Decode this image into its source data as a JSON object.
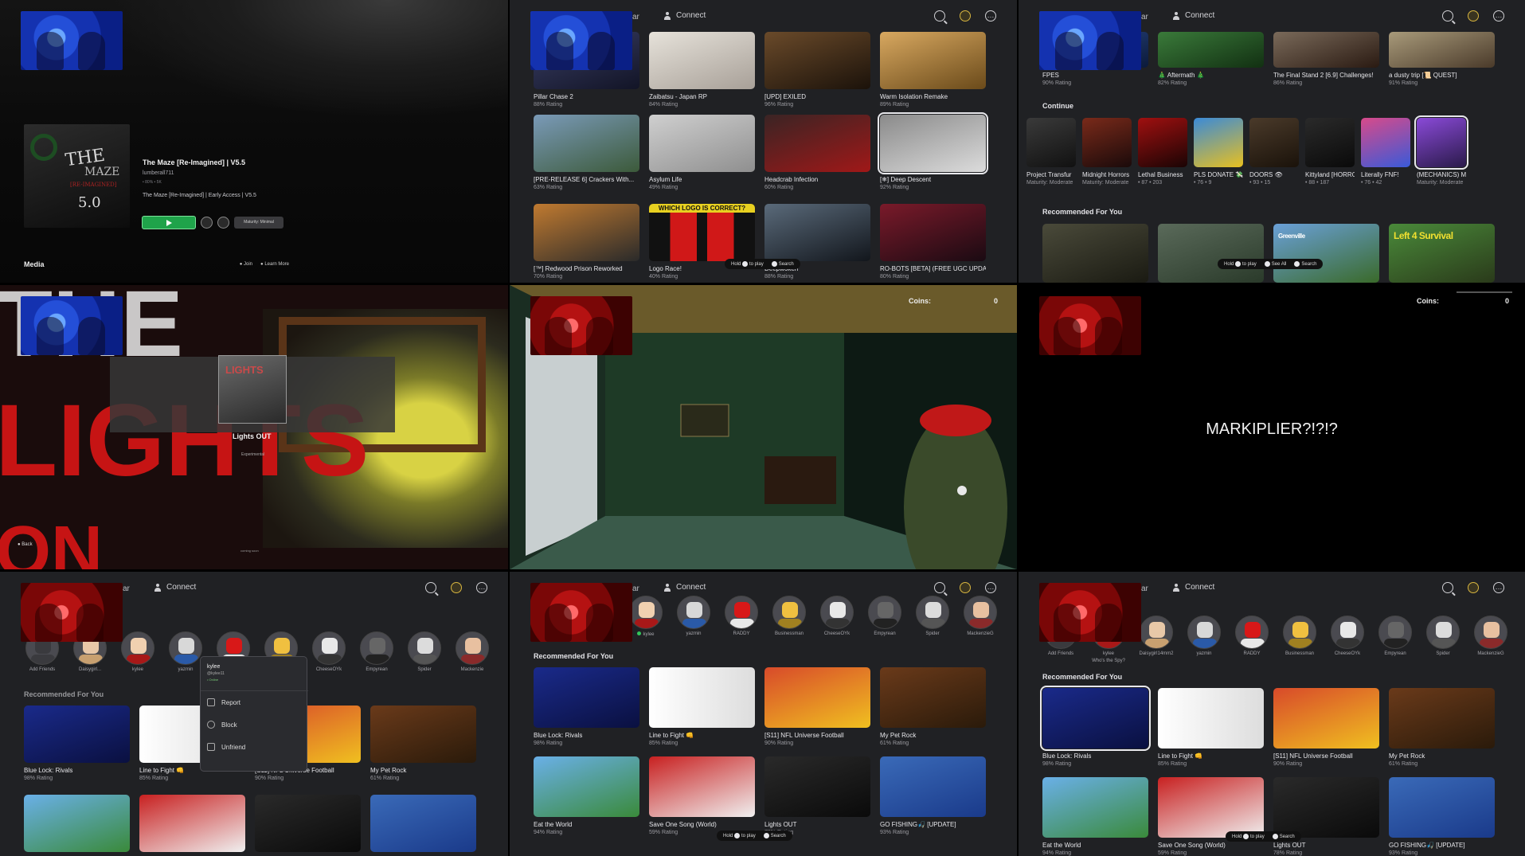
{
  "panel1": {
    "game_title": "The Maze [Re-Imagined] | V5.5",
    "developer": "lumberall711",
    "meta": "• 80%  • 5K",
    "description": "The Maze [Re-Imagined] | Early Access | V5.5",
    "thumb_logo": "THE",
    "thumb_logo2": "MAZE",
    "thumb_logo3": "[RE-IMAGINED]",
    "thumb_logo4": "5.0",
    "maturity": "Maturity: Minimal",
    "media_heading": "Media",
    "join_label": "Join",
    "learn_label": "Learn More"
  },
  "topbar": {
    "ar": "ar",
    "connect": "Connect"
  },
  "panel2": {
    "tiles": [
      {
        "title": "Pillar Chase 2",
        "rating": "88% Rating",
        "bg": "linear-gradient(160deg,#3a3f66,#121426)"
      },
      {
        "title": "Zaibatsu - Japan RP",
        "rating": "84% Rating",
        "bg": "linear-gradient(160deg,#e6e2da,#a8a098)"
      },
      {
        "title": "[UPD] EXILED",
        "rating": "96% Rating",
        "bg": "linear-gradient(160deg,#6a4a2a,#1b120a)"
      },
      {
        "title": "Warm Isolation Remake",
        "rating": "89% Rating",
        "bg": "linear-gradient(160deg,#d8a860,#6a4a1a)"
      },
      {
        "title": "[PRE-RELEASE 6] Crackers With...",
        "rating": "63% Rating",
        "bg": "linear-gradient(160deg,#7a9ab8,#3c5a3a)"
      },
      {
        "title": "Asylum Life",
        "rating": "49% Rating",
        "bg": "linear-gradient(160deg,#cfcfcf,#8f8f8f)"
      },
      {
        "title": "Headcrab Infection",
        "rating": "60% Rating",
        "bg": "linear-gradient(160deg,#3a2424,#a01818)"
      },
      {
        "title": "[❄] Deep Descent",
        "rating": "92% Rating",
        "bg": "linear-gradient(160deg,#8a8a8a,#dcdcdc)"
      },
      {
        "title": "[™] Redwood Prison Reworked",
        "rating": "70% Rating",
        "bg": "linear-gradient(160deg,#c07a30,#2a2a2a)"
      },
      {
        "title": "Logo Race!",
        "rating": "40% Rating",
        "bg": "linear-gradient(90deg,#111 0 20%,#d01818 20% 45%,#111 45% 55%,#d01818 55% 80%,#111 80%)"
      },
      {
        "title": "Deepwoken",
        "rating": "88% Rating",
        "bg": "linear-gradient(160deg,#5a6a7a,#12161c)"
      },
      {
        "title": "RO-BOTS [BETA] (FREE UGC UPDA...",
        "rating": "80% Rating",
        "bg": "linear-gradient(160deg,#7a1a2a,#1a0a12)"
      }
    ],
    "logo_race_text": "WHICH LOGO IS CORRECT?",
    "hint": {
      "hold": "Hold",
      "play": "to play",
      "search": "Search"
    }
  },
  "panel3": {
    "top_tiles": [
      {
        "title": "FPES",
        "rating": "90% Rating",
        "bg": "linear-gradient(160deg,#2a4a8a,#0c1a3a)"
      },
      {
        "title": "🎄 Aftermath 🎄",
        "rating": "82% Rating",
        "bg": "linear-gradient(160deg,#3a7a3a,#123012)"
      },
      {
        "title": "The Final Stand 2 [6.9] Challenges!",
        "rating": "86% Rating",
        "bg": "linear-gradient(160deg,#7a6a5a,#2a1a12)"
      },
      {
        "title": "a dusty trip [📜 QUEST]",
        "rating": "91% Rating",
        "bg": "linear-gradient(160deg,#a89a7a,#4a3a2a)"
      }
    ],
    "continue_heading": "Continue",
    "continue_items": [
      {
        "title": "Project Transfur",
        "sub": "Maturity: Moderate",
        "bg": "linear-gradient(160deg,#3a3a3a,#111)"
      },
      {
        "title": "Midnight Horrors",
        "sub": "Maturity: Moderate",
        "bg": "linear-gradient(160deg,#7a2a1a,#1a0a0a)"
      },
      {
        "title": "Lethal Business",
        "sub": "• 87  • 203",
        "bg": "linear-gradient(160deg,#a01010,#1a0404)"
      },
      {
        "title": "PLS DONATE 💸",
        "sub": "• 76  • 9",
        "bg": "linear-gradient(160deg,#3a8ad8,#e8c020)"
      },
      {
        "title": "DOORS 👁",
        "sub": "• 93  • 15",
        "bg": "linear-gradient(160deg,#4a3a2a,#1a120a)"
      },
      {
        "title": "Kittyland [HORROR][Beta]",
        "sub": "• 88  • 187",
        "bg": "linear-gradient(160deg,#2a2a2a,#0a0a0a)"
      },
      {
        "title": "Literally FNF!",
        "sub": "• 76  • 42",
        "bg": "linear-gradient(160deg,#d84a8a,#3a5ad8)"
      },
      {
        "title": "(MECHANICS) Monday Morning...",
        "sub": "Maturity: Moderate",
        "bg": "linear-gradient(160deg,#8a4ad8,#2a1a4a)"
      }
    ],
    "rec_heading": "Recommended For You",
    "rec_tiles": [
      {
        "title": "",
        "bg": "linear-gradient(160deg,#4a4a3a,#1a1a12)"
      },
      {
        "title": "",
        "bg": "linear-gradient(160deg,#5a6a5a,#2a3a2a)"
      },
      {
        "title": "Greenville",
        "bg": "linear-gradient(160deg,#6aa0d8,#3a6a2a)"
      },
      {
        "title": "Left 4 Survival",
        "bg": "linear-gradient(160deg,#4a8a3a,#2a3a1a)"
      }
    ],
    "hint": {
      "hold": "Hold",
      "play": "to play",
      "seeall": "See All",
      "search": "Search"
    }
  },
  "panel4": {
    "big_lines": [
      "THE",
      "LIGHTS",
      "ON"
    ],
    "thumb_text": "LIGHTS",
    "title": "Lights OUT",
    "subtitle": "Experimental",
    "back": "Back",
    "coming": "coming soon"
  },
  "panel5": {
    "coins_label": "Coins:",
    "coins_value": "0"
  },
  "panel6": {
    "coins_label": "Coins:",
    "coins_value": "0",
    "message": "MARKIPLIER?!?!?"
  },
  "panel7": {
    "friends": [
      {
        "name": "Add Friends",
        "head": "#3a3a3e",
        "body": "#3a3a3e"
      },
      {
        "name": "Daisygirl...",
        "head": "#e8c8a8",
        "body": "#c8a070"
      },
      {
        "name": "kylee",
        "head": "#f0d0b0",
        "body": "#a81818"
      },
      {
        "name": "yazmin",
        "head": "#d8d8d8",
        "body": "#2a5aa8"
      },
      {
        "name": "RADDY",
        "head": "#d81818",
        "body": "#e8e8e8"
      },
      {
        "name": "",
        "head": "#f0c040",
        "body": "#a08020"
      },
      {
        "name": "CheeseOYk",
        "head": "#e8e8e8",
        "body": "#333"
      },
      {
        "name": "Empyrean",
        "head": "#666",
        "body": "#222"
      },
      {
        "name": "Spider",
        "head": "#dcdcdc",
        "body": "#555"
      },
      {
        "name": "Mackenzie",
        "head": "#e8c0a0",
        "body": "#8a2a2a"
      }
    ],
    "rec_heading": "Recommended For You",
    "tiles": [
      {
        "title": "Blue Lock: Rivals",
        "rating": "98% Rating",
        "bg": "linear-gradient(160deg,#1a2a8a,#0a1040)"
      },
      {
        "title": "Line to Fight 👊",
        "rating": "85% Rating",
        "bg": "linear-gradient(90deg,#fff,#ddd)"
      },
      {
        "title": "[S11] NFL Universe Football",
        "rating": "90% Rating",
        "bg": "linear-gradient(160deg,#d84a2a,#f0c020)"
      },
      {
        "title": "My Pet Rock",
        "rating": "61% Rating",
        "bg": "linear-gradient(160deg,#6a3a1a,#2a1a0a)"
      }
    ],
    "row2": [
      {
        "bg": "linear-gradient(160deg,#6ab0e8,#3a8a3a)"
      },
      {
        "bg": "linear-gradient(160deg,#c82020,#f0f0f0)"
      },
      {
        "bg": "linear-gradient(160deg,#2a2a2a,#0a0a0a)"
      },
      {
        "bg": "linear-gradient(160deg,#3a6ab8,#1a3a8a)"
      }
    ],
    "menu": {
      "name": "kylee",
      "handle": "@kylee11",
      "status": "• Online",
      "report": "Report",
      "block": "Block",
      "unfriend": "Unfriend"
    }
  },
  "panel8": {
    "friends": [
      {
        "name": "kylee",
        "online": true,
        "head": "#f0d0b0",
        "body": "#a81818"
      },
      {
        "name": "yazmin",
        "online": false,
        "head": "#d8d8d8",
        "body": "#2a5aa8"
      },
      {
        "name": "RADDY",
        "online": false,
        "head": "#d81818",
        "body": "#e8e8e8"
      },
      {
        "name": "Businessman",
        "online": false,
        "head": "#f0c040",
        "body": "#a08020"
      },
      {
        "name": "CheeseOYk",
        "online": false,
        "head": "#e8e8e8",
        "body": "#333"
      },
      {
        "name": "Empyrean",
        "online": false,
        "head": "#666",
        "body": "#222"
      },
      {
        "name": "Spider",
        "online": false,
        "head": "#dcdcdc",
        "body": "#555"
      },
      {
        "name": "MackenzieG",
        "online": false,
        "head": "#e8c0a0",
        "body": "#8a2a2a"
      }
    ],
    "rec_heading": "Recommended For You",
    "tiles": [
      {
        "title": "Blue Lock: Rivals",
        "rating": "98% Rating",
        "bg": "linear-gradient(160deg,#1a2a8a,#0a1040)"
      },
      {
        "title": "Line to Fight 👊",
        "rating": "85% Rating",
        "bg": "linear-gradient(90deg,#fff,#ddd)"
      },
      {
        "title": "[S11] NFL Universe Football",
        "rating": "90% Rating",
        "bg": "linear-gradient(160deg,#d84a2a,#f0c020)"
      },
      {
        "title": "My Pet Rock",
        "rating": "61% Rating",
        "bg": "linear-gradient(160deg,#6a3a1a,#2a1a0a)"
      },
      {
        "title": "Eat the World",
        "rating": "94% Rating",
        "bg": "linear-gradient(160deg,#6ab0e8,#3a8a3a)"
      },
      {
        "title": "Save One Song (World)",
        "rating": "59% Rating",
        "bg": "linear-gradient(160deg,#c82020,#f0f0f0)"
      },
      {
        "title": "Lights OUT",
        "rating": "78% Rating",
        "bg": "linear-gradient(160deg,#2a2a2a,#0a0a0a)"
      },
      {
        "title": "GO FISHING🎣 [UPDATE]",
        "rating": "93% Rating",
        "bg": "linear-gradient(160deg,#3a6ab8,#1a3a8a)"
      }
    ],
    "hint": {
      "hold": "Hold",
      "play": "to play",
      "search": "Search"
    }
  },
  "panel9": {
    "friends": [
      {
        "name": "Add Friends",
        "sub": "",
        "head": "#3a3a3e",
        "body": "#3a3a3e"
      },
      {
        "name": "kylee",
        "sub": "Who's the Spy?",
        "head": "#f0d0b0",
        "body": "#a81818"
      },
      {
        "name": "Daisygirl14mm2",
        "sub": "",
        "head": "#e8c8a8",
        "body": "#c8a070"
      },
      {
        "name": "yazmin",
        "sub": "",
        "head": "#d8d8d8",
        "body": "#2a5aa8"
      },
      {
        "name": "RADDY",
        "sub": "",
        "head": "#d81818",
        "body": "#e8e8e8"
      },
      {
        "name": "Businessman",
        "sub": "",
        "head": "#f0c040",
        "body": "#a08020"
      },
      {
        "name": "CheeseOYk",
        "sub": "",
        "head": "#e8e8e8",
        "body": "#333"
      },
      {
        "name": "Empyrean",
        "sub": "",
        "head": "#666",
        "body": "#222"
      },
      {
        "name": "Spider",
        "sub": "",
        "head": "#dcdcdc",
        "body": "#555"
      },
      {
        "name": "MackenzieG",
        "sub": "",
        "head": "#e8c0a0",
        "body": "#8a2a2a"
      }
    ],
    "rec_heading": "Recommended For You",
    "tiles": [
      {
        "title": "Blue Lock: Rivals",
        "rating": "98% Rating",
        "bg": "linear-gradient(160deg,#1a2a8a,#0a1040)"
      },
      {
        "title": "Line to Fight 👊",
        "rating": "85% Rating",
        "bg": "linear-gradient(90deg,#fff,#ddd)"
      },
      {
        "title": "[S11] NFL Universe Football",
        "rating": "90% Rating",
        "bg": "linear-gradient(160deg,#d84a2a,#f0c020)"
      },
      {
        "title": "My Pet Rock",
        "rating": "61% Rating",
        "bg": "linear-gradient(160deg,#6a3a1a,#2a1a0a)"
      },
      {
        "title": "Eat the World",
        "rating": "94% Rating",
        "bg": "linear-gradient(160deg,#6ab0e8,#3a8a3a)"
      },
      {
        "title": "Save One Song (World)",
        "rating": "59% Rating",
        "bg": "linear-gradient(160deg,#c82020,#f0f0f0)"
      },
      {
        "title": "Lights OUT",
        "rating": "78% Rating",
        "bg": "linear-gradient(160deg,#2a2a2a,#0a0a0a)"
      },
      {
        "title": "GO FISHING🎣 [UPDATE]",
        "rating": "93% Rating",
        "bg": "linear-gradient(160deg,#3a6ab8,#1a3a8a)"
      }
    ],
    "hint": {
      "hold": "Hold",
      "play": "to play",
      "search": "Search"
    }
  }
}
